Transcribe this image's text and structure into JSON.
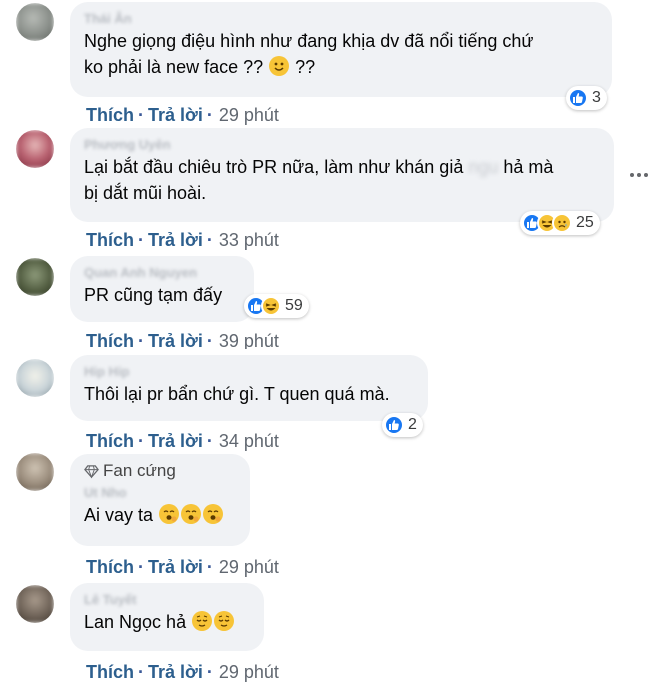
{
  "comments": [
    {
      "author": "Thái Ân",
      "text": "Nghe giọng điệu hình như đang khịa dv đã nổi tiếng chứ\nko phải là new face ?? ",
      "text_tail": " ??",
      "reaction_count": "3",
      "time": "29 phút",
      "avatar_color": "#8a8f8a"
    },
    {
      "author": "Phương Uyên",
      "text_pre": "Lại bắt đầu chiêu trò PR nữa, làm như khán giả ",
      "text_redacted": "ngu",
      "text_post": " hả mà\nbị dắt mũi hoài.",
      "reaction_count": "25",
      "time": "33 phút",
      "avatar_color": "#a04a5a"
    },
    {
      "author": "Quan Anh Nguyen",
      "text": "PR cũng tạm đấy",
      "reaction_count": "59",
      "time": "39 phút",
      "avatar_color": "#4f5a3e"
    },
    {
      "author": "Hip Hip",
      "text": "Thôi lại pr bẩn chứ gì. T quen quá mà.",
      "reaction_count": "2",
      "time": "34 phút",
      "avatar_color": "#c8d3d8"
    },
    {
      "badge": "Fan cứng",
      "author": "Ut Nho",
      "text": "Ai vay ta ",
      "time": "29 phút",
      "avatar_color": "#9a8c7c"
    },
    {
      "author": "Lê Tuyết",
      "text": "Lan Ngọc hả ",
      "time": "29 phút",
      "avatar_color": "#6f6358"
    }
  ],
  "actions": {
    "like_label": "Thích",
    "reply_label": "Trả lời",
    "separator": "·"
  },
  "colors": {
    "like_blue": "#1877f2",
    "link_blue": "#2d5f8e",
    "bubble_bg": "#f0f2f5"
  }
}
